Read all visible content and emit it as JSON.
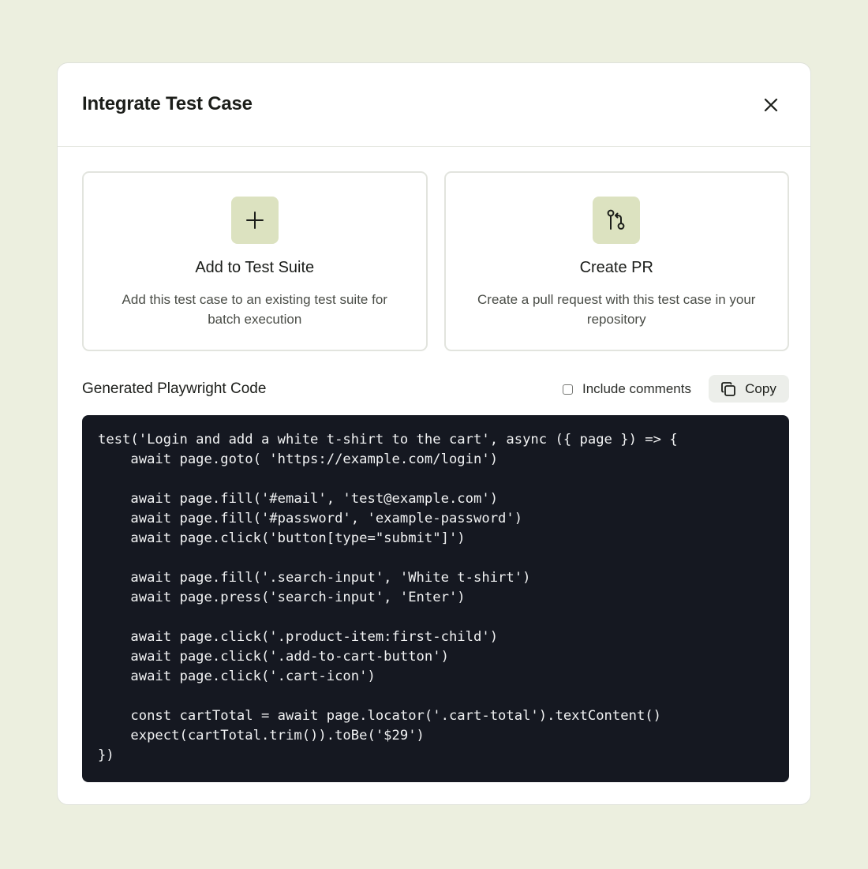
{
  "modal": {
    "title": "Integrate Test Case",
    "close_icon": "close-icon"
  },
  "cards": [
    {
      "icon": "plus-icon",
      "title": "Add to Test Suite",
      "description": "Add this test case to an existing test suite for batch execution"
    },
    {
      "icon": "git-pull-request-icon",
      "title": "Create PR",
      "description": "Create a pull request with this test case in your repository"
    }
  ],
  "code_section": {
    "heading": "Generated Playwright Code",
    "include_comments_label": "Include comments",
    "include_comments_checked": false,
    "copy_label": "Copy",
    "copy_icon": "copy-icon",
    "lines": [
      "test('Login and add a white t-shirt to the cart', async ({ page }) => {",
      "    await page.goto( 'https://example.com/login')",
      "",
      "    await page.fill('#email', 'test@example.com')",
      "    await page.fill('#password', 'example-password')",
      "    await page.click('button[type=\"submit\"]')",
      "",
      "    await page.fill('.search-input', 'White t-shirt')",
      "    await page.press('search-input', 'Enter')",
      "",
      "    await page.click('.product-item:first-child')",
      "    await page.click('.add-to-cart-button')",
      "    await page.click('.cart-icon')",
      "",
      "    const cartTotal = await page.locator('.cart-total').textContent()",
      "    expect(cartTotal.trim()).toBe('$29')",
      "})"
    ]
  },
  "colors": {
    "background": "#ecefdf",
    "icon_tile": "#dce2c0",
    "code_background": "#151821"
  }
}
